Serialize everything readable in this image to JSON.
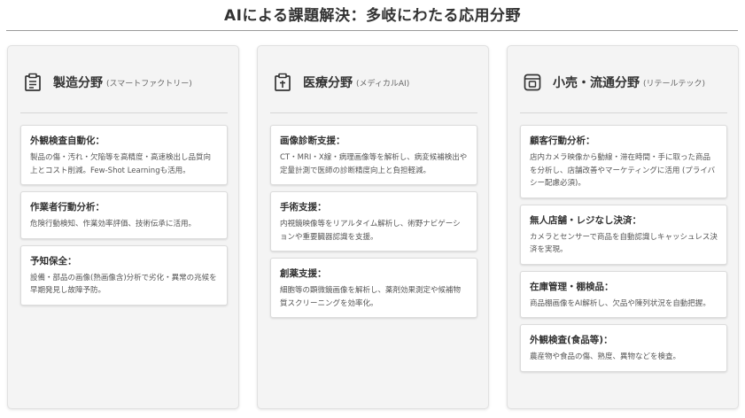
{
  "page": {
    "title": "AIによる課題解決：多岐にわたる応用分野"
  },
  "columns": [
    {
      "icon": "factory-icon",
      "name": "製造分野",
      "subtitle": "(スマートファクトリー)",
      "items": [
        {
          "title": "外観検査自動化：",
          "text": "製品の傷・汚れ・欠陥等を高精度・高速検出し品質向上とコスト削減。Few-Shot Learningも活用。"
        },
        {
          "title": "作業者行動分析：",
          "text": "危険行動検知、作業効率評価、技術伝承に活用。"
        },
        {
          "title": "予知保全：",
          "text": "設備・部品の画像(熱画像含)分析で劣化・異常の兆候を早期発見し故障予防。"
        }
      ]
    },
    {
      "icon": "medical-icon",
      "name": "医療分野",
      "subtitle": "(メディカルAI)",
      "items": [
        {
          "title": "画像診断支援：",
          "text": "CT・MRI・X線・病理画像等を解析し、病変候補検出や定量計測で医師の診断精度向上と負担軽減。"
        },
        {
          "title": "手術支援：",
          "text": "内視鏡映像等をリアルタイム解析し、術野ナビゲーションや重要臓器認識を支援。"
        },
        {
          "title": "創薬支援：",
          "text": "細胞等の顕微鏡画像を解析し、薬剤効果測定や候補物質スクリーニングを効率化。"
        }
      ]
    },
    {
      "icon": "retail-icon",
      "name": "小売・流通分野",
      "subtitle": "(リテールテック)",
      "items": [
        {
          "title": "顧客行動分析：",
          "text": "店内カメラ映像から動線・滞在時間・手に取った商品を分析し、店舗改善やマーケティングに活用 (プライバシー配慮必須)。"
        },
        {
          "title": "無人店舗・レジなし決済：",
          "text": "カメラとセンサーで商品を自動認識しキャッシュレス決済を実現。"
        },
        {
          "title": "在庫管理・棚検品：",
          "text": "商品棚画像をAI解析し、欠品や陳列状況を自動把握。"
        },
        {
          "title": "外観検査(食品等)：",
          "text": "農産物や食品の傷、熟度、異物などを検査。"
        }
      ]
    }
  ]
}
